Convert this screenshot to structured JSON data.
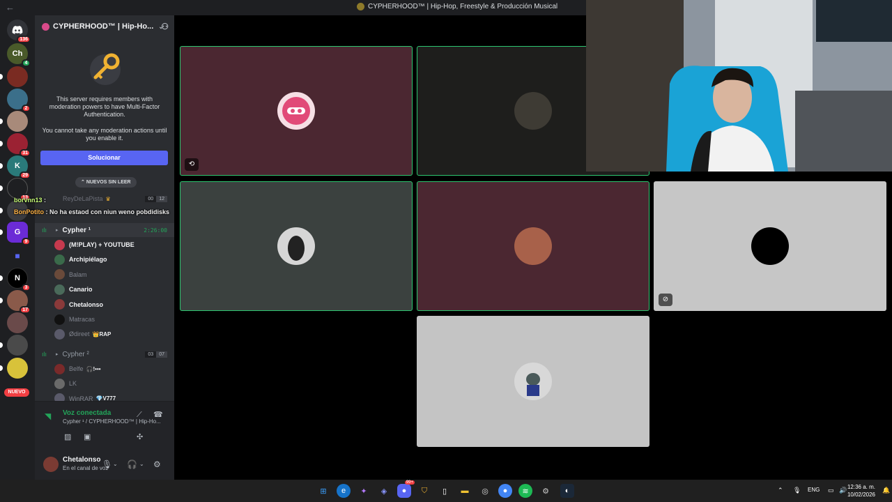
{
  "window": {
    "title": "CYPHERHOOD™ | Hip-Hop, Freestyle & Producción Musical",
    "back_icon": "←"
  },
  "rail": {
    "home_badge": "136",
    "badges": [
      "4",
      "2",
      "31",
      "29",
      "13",
      "9",
      "3",
      "17"
    ],
    "nuevo_label": "NUEVO"
  },
  "sidebar": {
    "server_name": "CYPHERHOOD™ | Hip-Ho...",
    "mfa_text": "This server requires members with moderation powers to have Multi-Factor Authentication.",
    "mfa_text2": "You cannot take any moderation actions until you enable it.",
    "fix_button": "Solucionar",
    "unread_pill": "NUEVOS SIN LEER",
    "channel_partial": "ReyDeLaPista",
    "channel_partial_counts": [
      "00",
      "12"
    ],
    "cypher1": {
      "name": "Cypher ¹",
      "timer": "2:26:00"
    },
    "cypher2": {
      "name": "Cypher ²",
      "counts": [
        "03",
        "07"
      ]
    },
    "members1": [
      {
        "name": "(M!PLAY) + YOUTUBE",
        "bright": true
      },
      {
        "name": "Archipiélago",
        "bright": true
      },
      {
        "name": "Balam",
        "bright": false
      },
      {
        "name": "Canario",
        "bright": true
      },
      {
        "name": "Chetalonso",
        "bright": true
      },
      {
        "name": "Matracas",
        "bright": false
      },
      {
        "name": "Ødireet",
        "bright": false,
        "tag": "👑RAP"
      }
    ],
    "members2": [
      {
        "name": "Belfe",
        "tag": "🎧!•••"
      },
      {
        "name": "LK",
        "tag": ""
      },
      {
        "name": "WinRAR",
        "tag": "💎V777"
      }
    ]
  },
  "overlay_chat": [
    {
      "user": "borvnn13",
      "text": ":"
    },
    {
      "user": "BonPotito",
      "text": ": No ha estaod con niun weno pobdidisks"
    }
  ],
  "voice": {
    "status": "Voz conectada",
    "channel": "Cypher ¹ / CYPHERHOOD™ | Hip-Ho..."
  },
  "user": {
    "name": "Chetalonso",
    "status": "En el canal de voz"
  },
  "taskbar": {
    "lang": "ENG",
    "time": "12:36 a. m.",
    "date": "10/02/2026",
    "notif_badge": "99+"
  },
  "colors": {
    "accent": "#5865f2",
    "speaking": "#2dc770",
    "online": "#23a55a",
    "badge": "#f23f43"
  }
}
